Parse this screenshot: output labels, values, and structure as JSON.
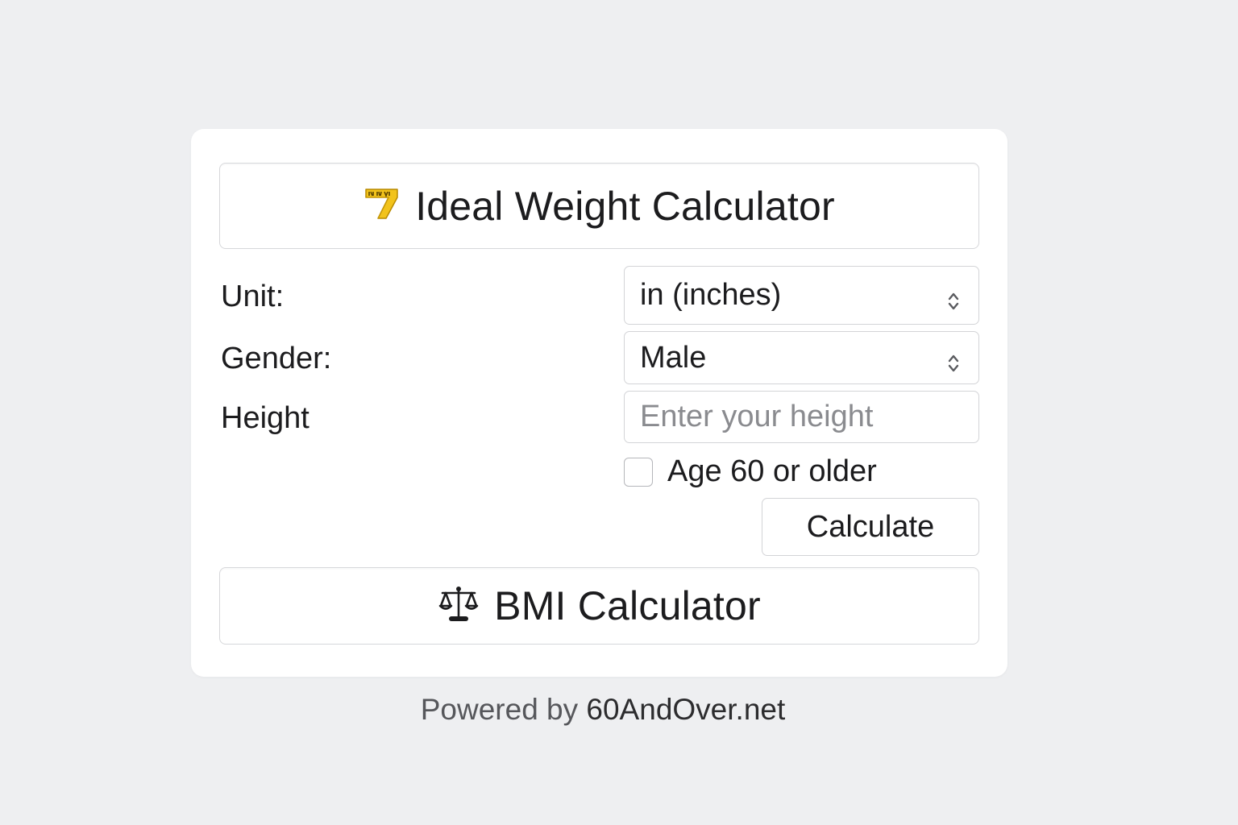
{
  "ideal_weight": {
    "title": "Ideal Weight Calculator",
    "icon": "measuring-tape-icon"
  },
  "form": {
    "unit": {
      "label": "Unit:",
      "value": "in (inches)"
    },
    "gender": {
      "label": "Gender:",
      "value": "Male"
    },
    "height": {
      "label": "Height",
      "placeholder": "Enter your height"
    },
    "age_checkbox": {
      "label": "Age 60 or older",
      "checked": false
    },
    "calculate_label": "Calculate"
  },
  "bmi": {
    "title": "BMI Calculator",
    "icon": "balance-scale-icon"
  },
  "footer": {
    "prefix": "Powered by",
    "link": "60AndOver.net"
  },
  "colors": {
    "background": "#eeeff1",
    "card": "#ffffff",
    "border": "#d3d4d7",
    "tape_yellow": "#f2c31b"
  }
}
